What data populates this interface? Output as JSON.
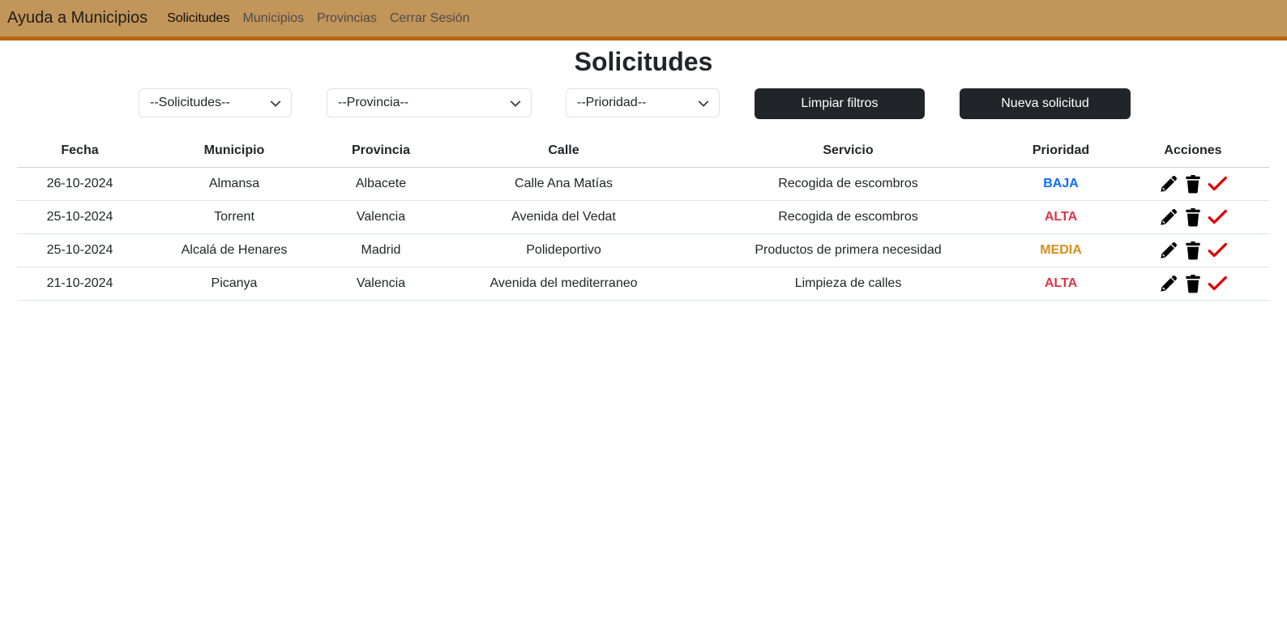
{
  "navbar": {
    "brand": "Ayuda a Municipios",
    "links": [
      "Solicitudes",
      "Municipios",
      "Provincias",
      "Cerrar Sesión"
    ]
  },
  "page_title": "Solicitudes",
  "filters": {
    "solicitudes": "--Solicitudes--",
    "provincia": "--Provincia--",
    "prioridad": "--Prioridad--",
    "clear_label": "Limpiar filtros",
    "new_label": "Nueva solicitud"
  },
  "table": {
    "headers": [
      "Fecha",
      "Municipio",
      "Provincia",
      "Calle",
      "Servicio",
      "Prioridad",
      "Acciones"
    ],
    "rows": [
      {
        "fecha": "26-10-2024",
        "municipio": "Almansa",
        "provincia": "Albacete",
        "calle": "Calle Ana Matías",
        "servicio": "Recogida de escombros",
        "prioridad": "BAJA"
      },
      {
        "fecha": "25-10-2024",
        "municipio": "Torrent",
        "provincia": "Valencia",
        "calle": "Avenida del Vedat",
        "servicio": "Recogida de escombros",
        "prioridad": "ALTA"
      },
      {
        "fecha": "25-10-2024",
        "municipio": "Alcalá de Henares",
        "provincia": "Madrid",
        "calle": "Polideportivo",
        "servicio": "Productos de primera necesidad",
        "prioridad": "MEDIA"
      },
      {
        "fecha": "21-10-2024",
        "municipio": "Picanya",
        "provincia": "Valencia",
        "calle": "Avenida del mediterraneo",
        "servicio": "Limpieza de calles",
        "prioridad": "ALTA"
      }
    ]
  },
  "colors": {
    "navbar": "#c29558",
    "navbar_border": "#b8660f",
    "baja": "#0d6efd",
    "alta": "#dc3545",
    "media": "#d4901a",
    "check": "#e00000"
  },
  "icons": [
    "pencil-icon",
    "trash-icon",
    "check-icon",
    "chevron-down-icon"
  ]
}
